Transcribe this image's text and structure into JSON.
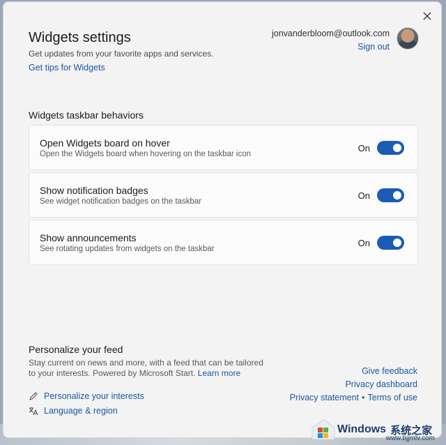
{
  "header": {
    "title": "Widgets settings",
    "subtitle": "Get updates from your favorite apps and services.",
    "tips_link": "Get tips for Widgets"
  },
  "account": {
    "email": "jonvanderbloom@outlook.com",
    "sign_out": "Sign out"
  },
  "behaviors": {
    "section_title": "Widgets taskbar behaviors",
    "items": [
      {
        "title": "Open Widgets board on hover",
        "description": "Open the Widgets board when hovering on the taskbar icon",
        "state": "On"
      },
      {
        "title": "Show notification badges",
        "description": "See widget notification badges on the taskbar",
        "state": "On"
      },
      {
        "title": "Show announcements",
        "description": "See rotating updates from widgets on the taskbar",
        "state": "On"
      }
    ]
  },
  "feed": {
    "title": "Personalize your feed",
    "description": "Stay current on news and more, with a feed that can be tailored to your interests. Powered by Microsoft Start.",
    "learn_more": "Learn more",
    "personalize_link": "Personalize your interests",
    "language_link": "Language & region"
  },
  "footer": {
    "give_feedback": "Give feedback",
    "privacy_dashboard": "Privacy dashboard",
    "privacy_statement": "Privacy statement",
    "separator": "•",
    "terms_of_use": "Terms of use"
  },
  "watermark": {
    "brand": "Windows",
    "cn": "系统之家",
    "url": "www.bjjmlv.com"
  },
  "colors": {
    "accent": "#1a5cb4",
    "link": "#1a57a0",
    "panel_bg": "#f3f3f3",
    "card_bg": "#fbfbfb"
  },
  "icons": [
    "close-icon",
    "avatar",
    "pencil-icon",
    "language-icon",
    "windows-logo-icon"
  ]
}
